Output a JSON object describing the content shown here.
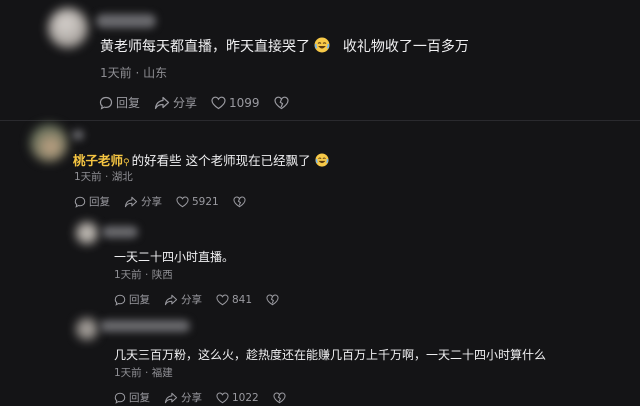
{
  "comments": [
    {
      "text_a": "黄老师每天都直播，昨天直接哭了",
      "text_b": "收礼物收了一百多万",
      "time": "1天前",
      "location": "山东",
      "reply_label": "回复",
      "share_label": "分享",
      "likes": "1099"
    },
    {
      "author": "桃子老师",
      "text": "的好看些 这个老师现在已经飘了",
      "time": "1天前",
      "location": "湖北",
      "reply_label": "回复",
      "share_label": "分享",
      "likes": "5921"
    },
    {
      "text": "一天二十四小时直播。",
      "time": "1天前",
      "location": "陕西",
      "reply_label": "回复",
      "share_label": "分享",
      "likes": "841"
    },
    {
      "text": "几天三百万粉，这么火，趁热度还在能赚几百万上千万啊，一天二十四小时算什么",
      "time": "1天前",
      "location": "福建",
      "reply_label": "回复",
      "share_label": "分享",
      "likes": "1022"
    }
  ],
  "separator": "·",
  "colors": {
    "background": "#141416",
    "author": "#f5c542",
    "meta": "#8e8e93"
  }
}
